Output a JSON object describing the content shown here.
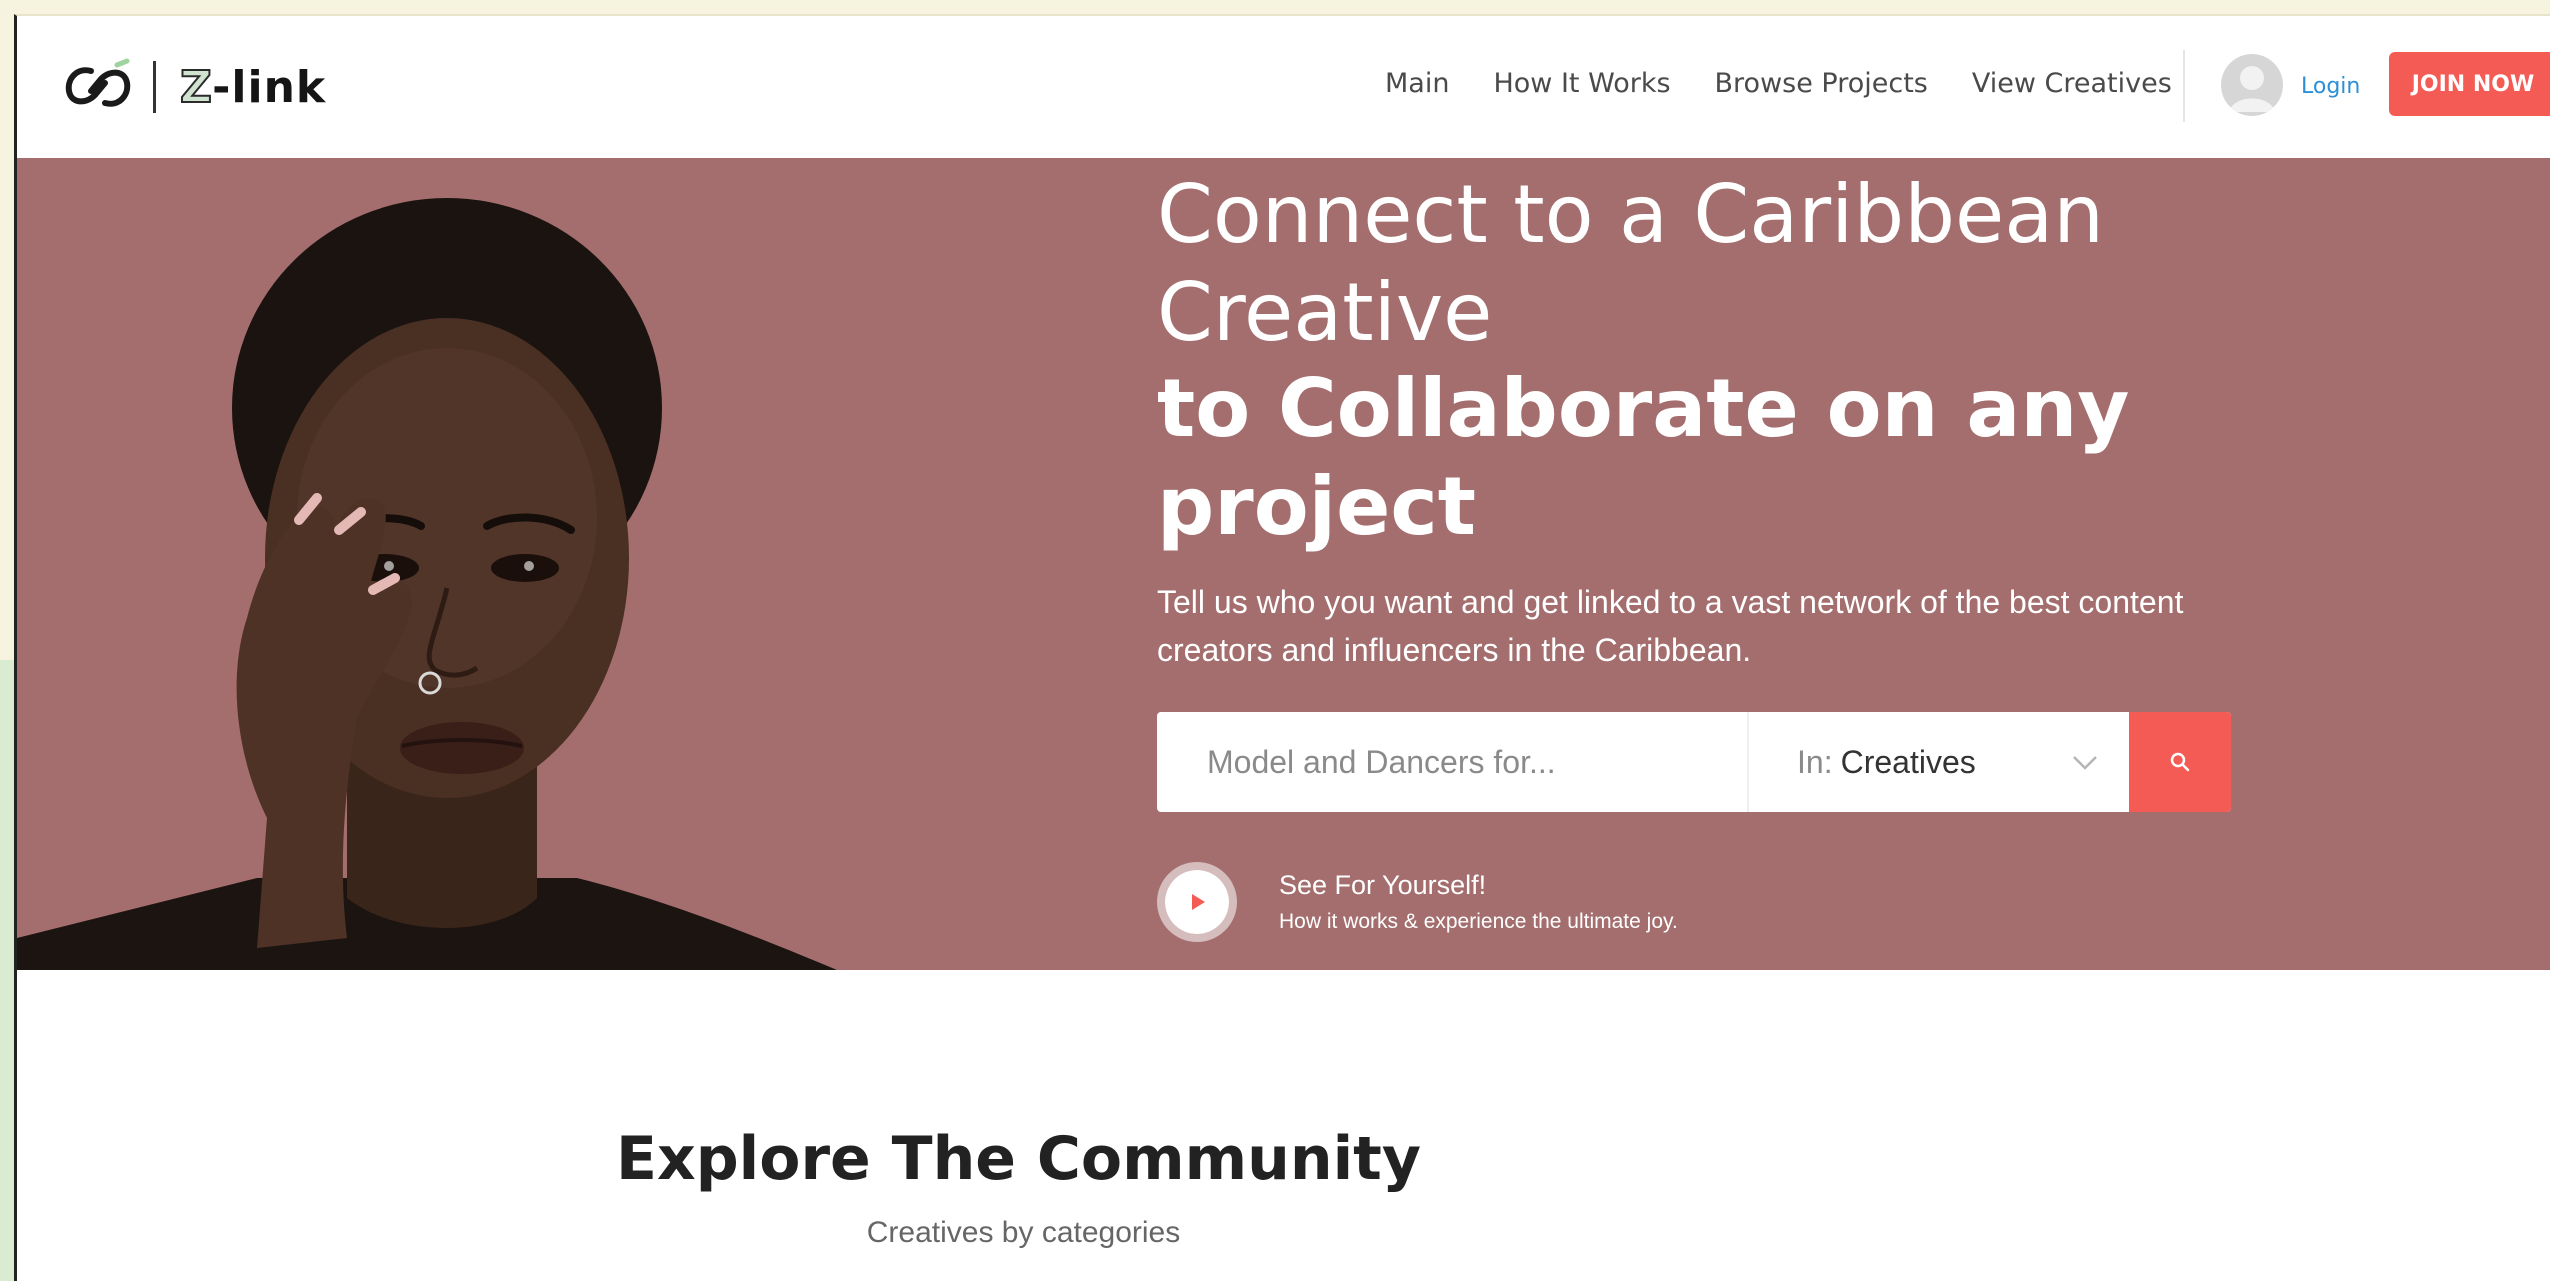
{
  "brand": {
    "logo_text_z": "Z",
    "logo_text_rest": "-link"
  },
  "nav": {
    "items": [
      {
        "label": "Main"
      },
      {
        "label": "How It Works"
      },
      {
        "label": "Browse Projects"
      },
      {
        "label": "View Creatives"
      }
    ],
    "login_label": "Login",
    "join_label": "JOIN NOW"
  },
  "hero": {
    "title_line1": "Connect to a Caribbean",
    "title_line2": "Creative",
    "title_bold_line1": "to Collaborate on any",
    "title_bold_line2": "project",
    "subtitle_line1": "Tell us who you want and get linked to a vast network of the best content",
    "subtitle_line2": "creators and influencers in the Caribbean.",
    "search": {
      "placeholder": "Model and Dancers for...",
      "category_prefix": "In:",
      "category_value": "Creatives"
    },
    "video": {
      "title": "See For Yourself!",
      "subtitle": "How it works & experience the ultimate joy."
    }
  },
  "explore": {
    "title": "Explore The Community",
    "subtitle": "Creatives by categories"
  },
  "colors": {
    "accent": "#f45b55",
    "hero_bg": "#a46e6e",
    "link": "#2d8fd5"
  }
}
